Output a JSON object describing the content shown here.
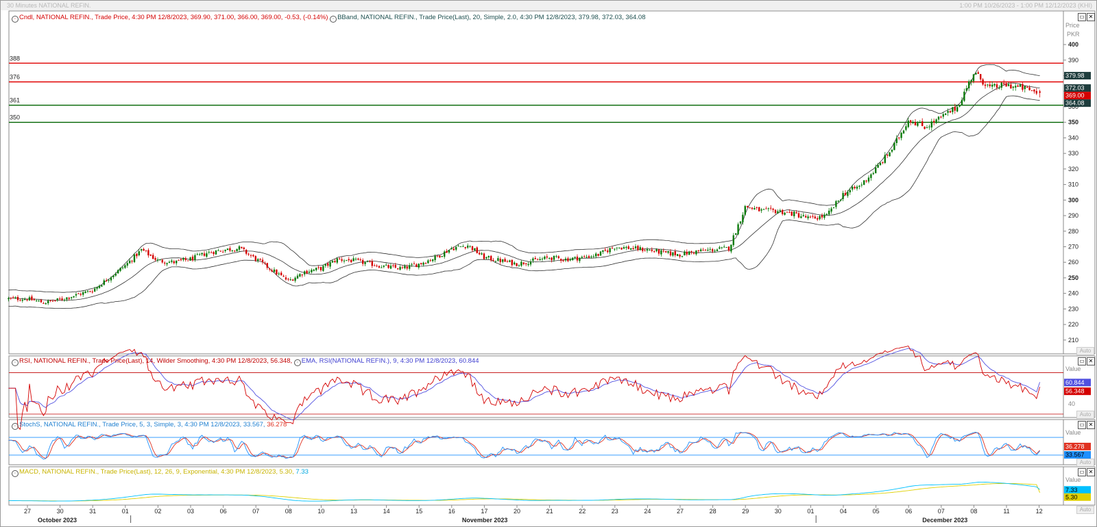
{
  "window": {
    "title": "30 Minutes NATIONAL REFIN.",
    "range": "1:00 PM 10/26/2023 - 1:00 PM 12/12/2023 (KHI)"
  },
  "colors": {
    "up": "#0a7a0a",
    "down": "#d40000",
    "resistance": "#e00000",
    "support": "#006400",
    "bband": "#303030",
    "rsi": "#d40000",
    "rsi_ema": "#5050e0",
    "stoch_k": "#1e90ff",
    "stoch_d": "#e03020",
    "macd": "#00c0ff",
    "macd_signal": "#e0d000"
  },
  "panels": {
    "price": {
      "legend_cndl": "Cndl, NATIONAL REFIN., Trade Price, 4:30 PM 12/8/2023, 369.90, 371.00, 366.00, 369.00, -0.53, (-0.14%)",
      "legend_bband": "BBand, NATIONAL REFIN., Trade Price(Last),  20, Simple, 2.0, 4:30 PM 12/8/2023, 379.98, 372.03, 364.08",
      "axis_head1": "Price",
      "axis_head2": "PKR",
      "auto_label": "Auto"
    },
    "rsi": {
      "legend_rsi": "RSI, NATIONAL REFIN., Trade Price(Last),  14, Wilder Smoothing,  4:30 PM 12/8/2023, 56.348,",
      "legend_ema": "EMA, RSI(NATIONAL REFIN.),  9,  4:30 PM 12/8/2023, 60.844",
      "axis_head": "Value",
      "auto_label": "Auto"
    },
    "stoch": {
      "legend": "StochS, NATIONAL REFIN., Trade Price,  5, 3, Simple, 3,  4:30 PM 12/8/2023, 33.567,",
      "legend_d": "36.278",
      "axis_head": "Value",
      "auto_label": "Auto"
    },
    "macd": {
      "legend": "MACD, NATIONAL REFIN., Trade Price(Last),  12, 26, 9, Exponential,  4:30 PM 12/8/2023, 5.30,",
      "legend_signal": "7.33",
      "axis_head": "Value",
      "auto_label": "Auto"
    }
  },
  "chart_data": [
    {
      "type": "candlestick",
      "title": "30 Minutes NATIONAL REFIN.",
      "ylabel": "Price PKR",
      "ylim": [
        202,
        404
      ],
      "yticks": [
        210,
        220,
        230,
        240,
        250,
        260,
        270,
        280,
        290,
        300,
        310,
        320,
        330,
        340,
        350,
        360,
        370,
        380,
        390,
        400
      ],
      "x_dates": [
        "27",
        "30",
        "31",
        "01",
        "02",
        "03",
        "06",
        "07",
        "08",
        "10",
        "13",
        "14",
        "15",
        "16",
        "17",
        "20",
        "21",
        "22",
        "23",
        "24",
        "27",
        "28",
        "29",
        "30",
        "01",
        "04",
        "05",
        "06",
        "07",
        "08",
        "11",
        "12"
      ],
      "x_months": [
        {
          "label": "October 2023",
          "at_day": 0.6
        },
        {
          "label": "November 2023",
          "at_day": 13.7
        },
        {
          "label": "December 2023",
          "at_day": 27.8
        }
      ],
      "horizontal_lines": [
        {
          "y": 388,
          "label": "388",
          "kind": "resistance"
        },
        {
          "y": 376,
          "label": "376",
          "kind": "resistance"
        },
        {
          "y": 361,
          "label": "361",
          "kind": "support"
        },
        {
          "y": 350,
          "label": "350",
          "kind": "support"
        }
      ],
      "close_path": [
        [
          0,
          236.5
        ],
        [
          0.5,
          234
        ],
        [
          1,
          236
        ],
        [
          1.5,
          239
        ],
        [
          2,
          242
        ],
        [
          2.5,
          250
        ],
        [
          3,
          258
        ],
        [
          3.5,
          268
        ],
        [
          4,
          261
        ],
        [
          4.5,
          260
        ],
        [
          5,
          262
        ],
        [
          5.5,
          266
        ],
        [
          6,
          268
        ],
        [
          6.5,
          269
        ],
        [
          7,
          262
        ],
        [
          7.5,
          255
        ],
        [
          8,
          248
        ],
        [
          8.5,
          254
        ],
        [
          9,
          256
        ],
        [
          9.5,
          262
        ],
        [
          10,
          261
        ],
        [
          10.5,
          259
        ],
        [
          11,
          257
        ],
        [
          11.5,
          256
        ],
        [
          12,
          259
        ],
        [
          12.5,
          263
        ],
        [
          13,
          269
        ],
        [
          13.5,
          271
        ],
        [
          14,
          263
        ],
        [
          14.5,
          261
        ],
        [
          15,
          259
        ],
        [
          15.5,
          261
        ],
        [
          16,
          263
        ],
        [
          16.5,
          262
        ],
        [
          17,
          263
        ],
        [
          17.5,
          265
        ],
        [
          18,
          270
        ],
        [
          18.5,
          269
        ],
        [
          19,
          268
        ],
        [
          19.5,
          266
        ],
        [
          20,
          265
        ],
        [
          20.5,
          267
        ],
        [
          21,
          268
        ],
        [
          21.5,
          269
        ],
        [
          22,
          296
        ],
        [
          22.5,
          293
        ],
        [
          23,
          293
        ],
        [
          23.5,
          291
        ],
        [
          24,
          288
        ],
        [
          24.5,
          290
        ],
        [
          25,
          304
        ],
        [
          25.5,
          309
        ],
        [
          26,
          320
        ],
        [
          26.5,
          333
        ],
        [
          27,
          352
        ],
        [
          27.5,
          347
        ],
        [
          28,
          353
        ],
        [
          28.5,
          360
        ],
        [
          29,
          382
        ],
        [
          29.5,
          372
        ],
        [
          30,
          374
        ],
        [
          30.5,
          372
        ],
        [
          31,
          369
        ]
      ],
      "bband_last": {
        "upper": 379.98,
        "middle": 372.03,
        "lower": 364.08
      },
      "price_tags": [
        {
          "label": "379.98",
          "y": 379.98,
          "kind": "upper"
        },
        {
          "label": "372.03",
          "y": 372.03,
          "kind": "middle"
        },
        {
          "label": "369.00",
          "y": 369.0,
          "kind": "close"
        },
        {
          "label": "364.08",
          "y": 364.08,
          "kind": "lower"
        }
      ],
      "last_candle": {
        "open": 369.9,
        "high": 371.0,
        "low": 366.0,
        "close": 369.0,
        "change": -0.53,
        "change_pct": "-0.14%"
      }
    },
    {
      "type": "line",
      "title": "RSI",
      "ylim": [
        28,
        77
      ],
      "levels": [
        70,
        30
      ],
      "yticks_visible": [
        40
      ],
      "series": [
        {
          "name": "RSI",
          "last": 56.348
        },
        {
          "name": "EMA",
          "last": 60.844
        }
      ],
      "value_tags": [
        "60.844",
        "56.348",
        "40"
      ]
    },
    {
      "type": "line",
      "title": "StochS",
      "ylim": [
        -8,
        108
      ],
      "levels": [
        80,
        20
      ],
      "series": [
        {
          "name": "StochS %K",
          "last": 33.567
        },
        {
          "name": "StochS %D",
          "last": 36.278
        }
      ],
      "value_tags": [
        "36.278",
        "33.567"
      ]
    },
    {
      "type": "line",
      "title": "MACD",
      "ylim": [
        -2,
        16
      ],
      "series": [
        {
          "name": "MACD",
          "last": 7.33
        },
        {
          "name": "Signal",
          "last": 5.3
        }
      ],
      "value_tags": [
        "7.33",
        "5.30"
      ]
    }
  ]
}
